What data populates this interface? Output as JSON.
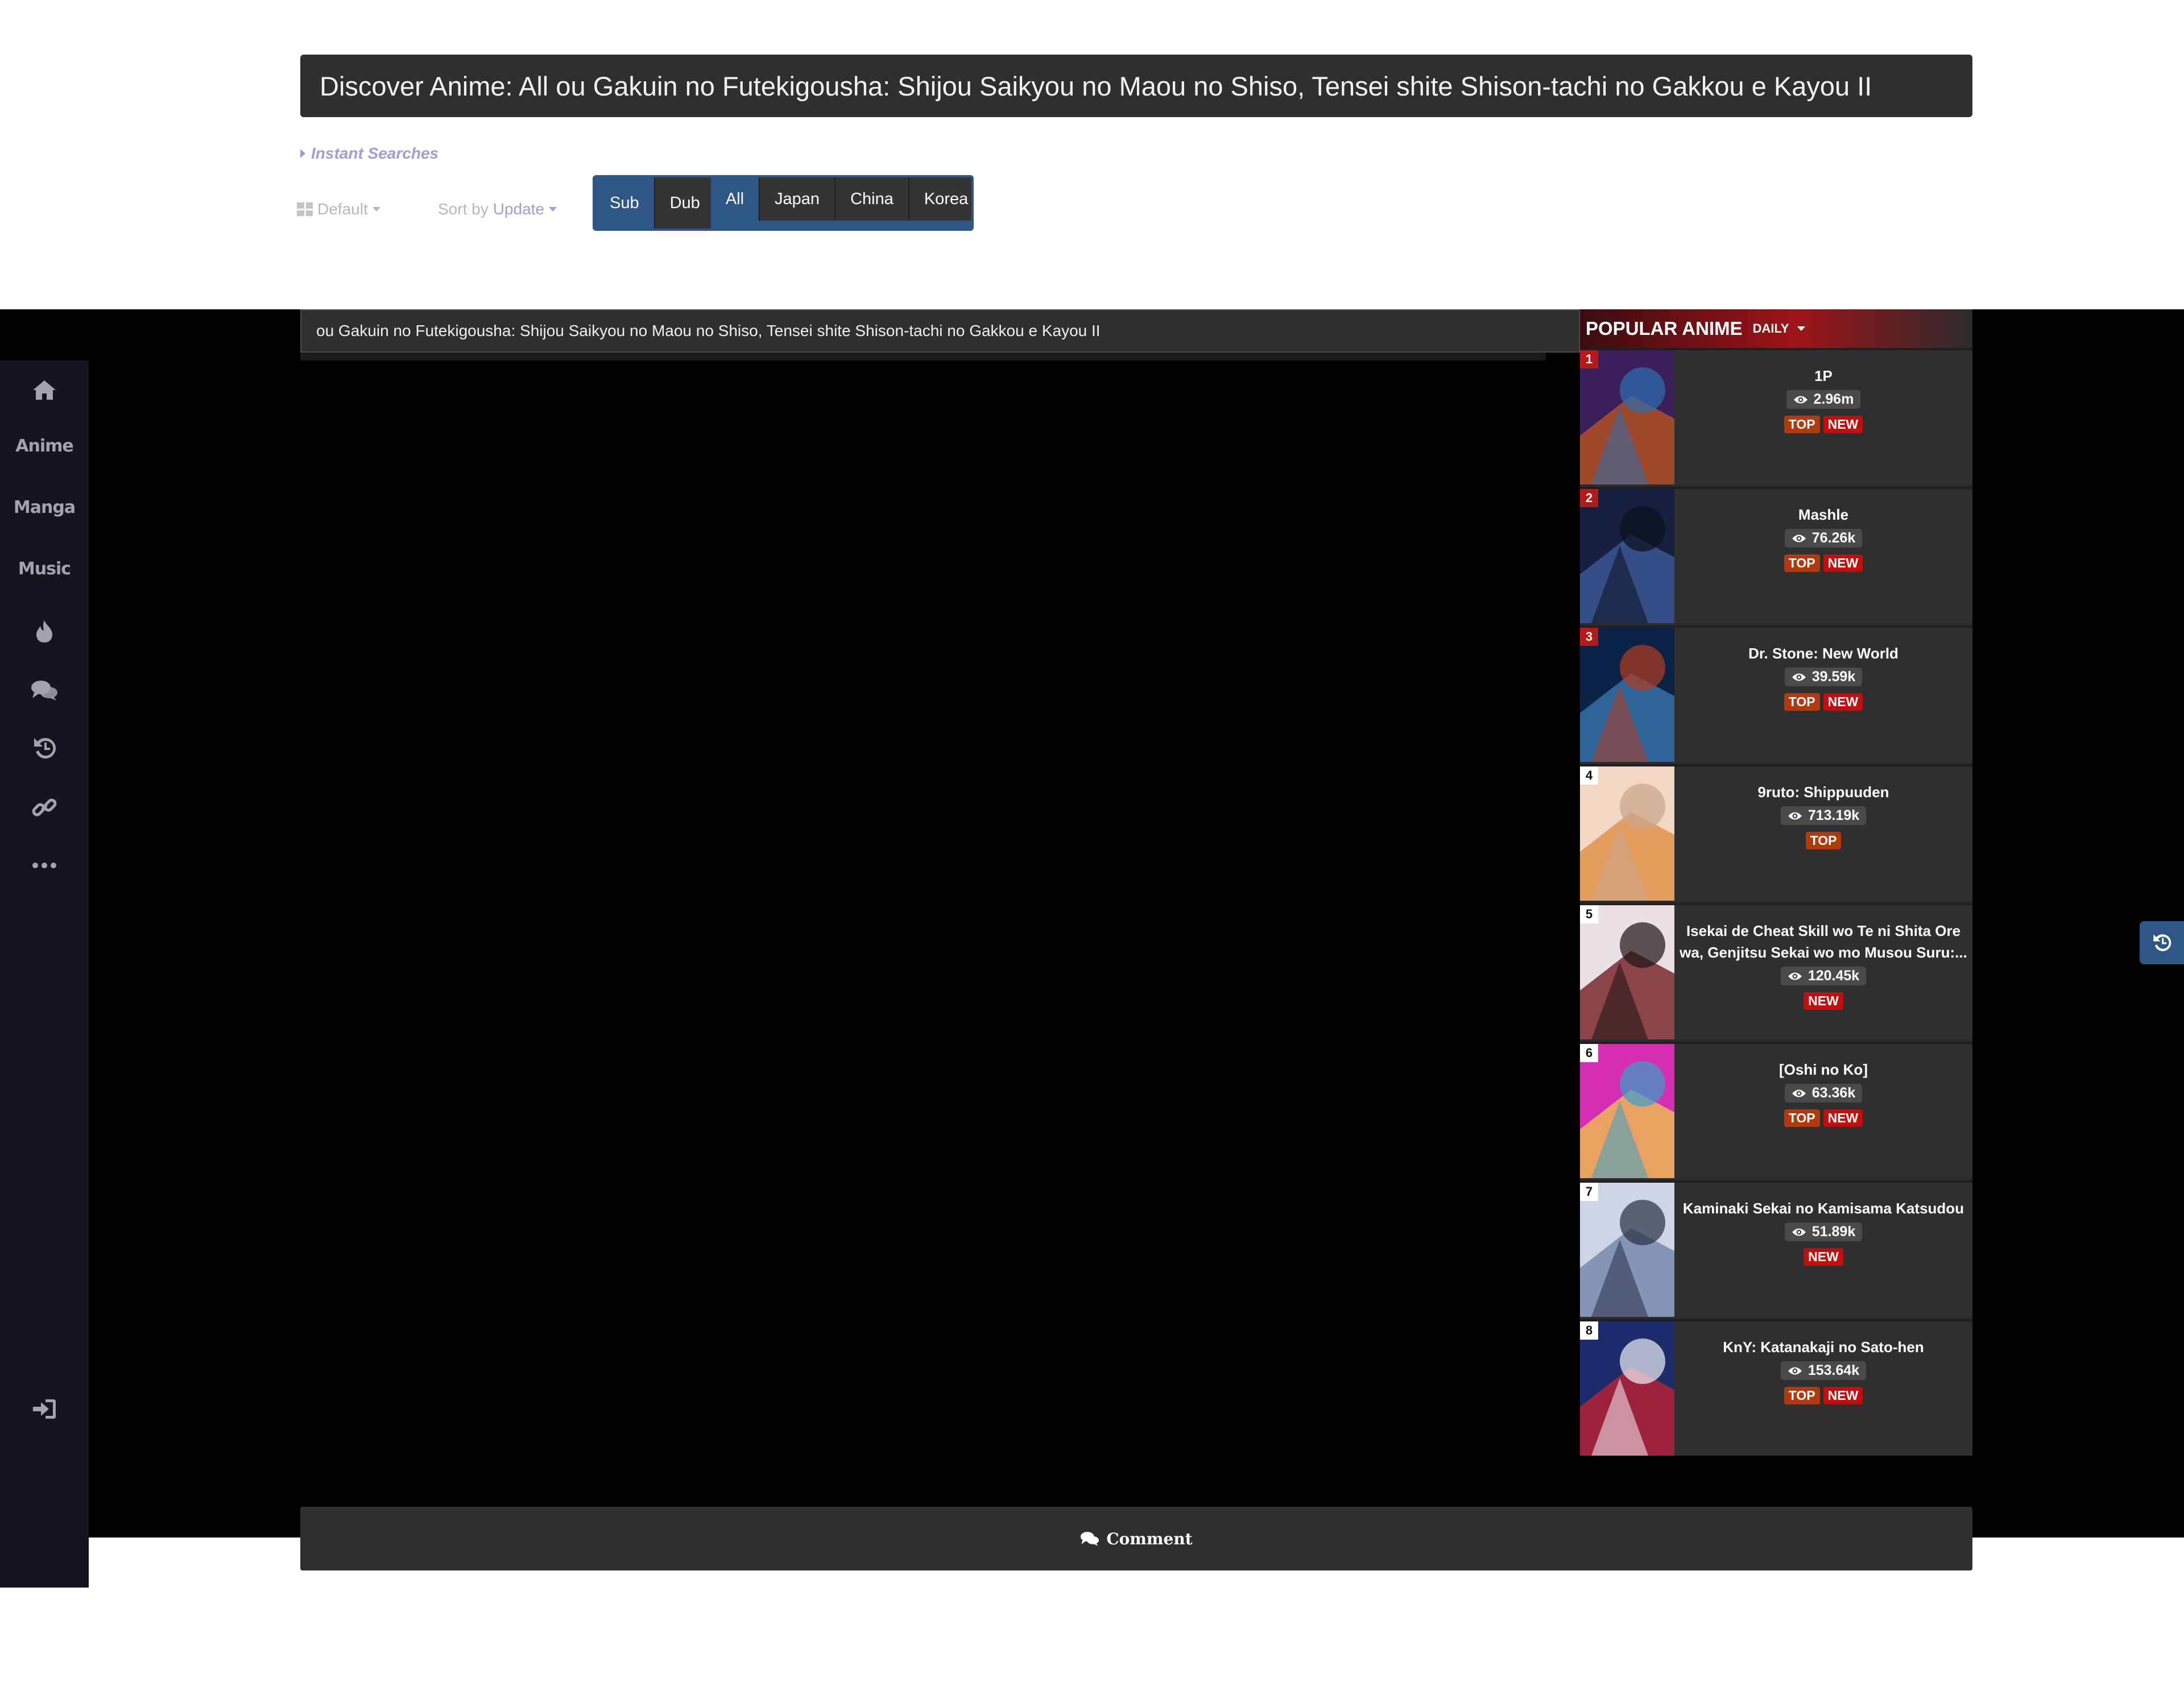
{
  "page": {
    "title": "Discover Anime: All ou Gakuin no Futekigousha: Shijou Saikyou no Maou no Shiso, Tensei shite Shison-tachi no Gakkou e Kayou II"
  },
  "filters": {
    "instant_searches": "Instant Searches",
    "view_label": "Default",
    "sort_prefix": "Sort by",
    "sort_value": "Update",
    "language": [
      {
        "label": "Sub",
        "active": true
      },
      {
        "label": "Dub",
        "active": false
      }
    ],
    "region": [
      {
        "label": "All",
        "active": true
      },
      {
        "label": "Japan",
        "active": false
      },
      {
        "label": "China",
        "active": false
      },
      {
        "label": "Korea",
        "active": false
      }
    ]
  },
  "search": {
    "value": "ou Gakuin no Futekigousha: Shijou Saikyou no Maou no Shiso, Tensei shite Shison-tachi no Gakkou e Kayou II"
  },
  "sidebar": {
    "items": [
      {
        "type": "icon",
        "icon": "home-icon"
      },
      {
        "type": "text",
        "label": "Anime"
      },
      {
        "type": "text",
        "label": "Manga"
      },
      {
        "type": "text",
        "label": "Music"
      },
      {
        "type": "icon",
        "icon": "fire-icon"
      },
      {
        "type": "icon",
        "icon": "comments-icon"
      },
      {
        "type": "icon",
        "icon": "history-icon"
      },
      {
        "type": "icon",
        "icon": "link-icon"
      },
      {
        "type": "icon",
        "icon": "more-icon"
      },
      {
        "type": "icon",
        "icon": "sign-in-icon"
      }
    ]
  },
  "popular": {
    "title": "POPULAR ANIME",
    "period": "DAILY",
    "items": [
      {
        "rank": "1",
        "name": "1P",
        "views": "2.96m",
        "top": "TOP",
        "new": "NEW",
        "colors": [
          "#3a1f5a",
          "#c2571d",
          "#2b6fb0"
        ]
      },
      {
        "rank": "2",
        "name": "Mashle",
        "views": "76.26k",
        "top": "TOP",
        "new": "NEW",
        "colors": [
          "#17213f",
          "#3f5fa0",
          "#0d0f1c"
        ]
      },
      {
        "rank": "3",
        "name": "Dr. Stone: New World",
        "views": "39.59k",
        "top": "TOP",
        "new": "NEW",
        "colors": [
          "#0a2346",
          "#3a79b6",
          "#b23a1b"
        ]
      },
      {
        "rank": "4",
        "name": "9ruto: Shippuuden",
        "views": "713.19k",
        "top": "TOP",
        "new": "",
        "colors": [
          "#f1d7c4",
          "#e08a3c",
          "#c9a58c"
        ]
      },
      {
        "rank": "5",
        "name": "Isekai de Cheat Skill wo Te ni Shita Ore wa, Genjitsu Sekai wo mo Musou Suru:...",
        "views": "120.45k",
        "top": "",
        "new": "NEW",
        "colors": [
          "#e9e1e3",
          "#6b0f14",
          "#1c1416"
        ]
      },
      {
        "rank": "6",
        "name": "[Oshi no Ko]",
        "views": "63.36k",
        "top": "TOP",
        "new": "NEW",
        "colors": [
          "#d42fb1",
          "#f1c94a",
          "#36a0c9"
        ]
      },
      {
        "rank": "7",
        "name": "Kaminaki Sekai no Kamisama Katsudou",
        "views": "51.89k",
        "top": "",
        "new": "NEW",
        "colors": [
          "#cfd5e6",
          "#6c7fa6",
          "#2a2d45"
        ]
      },
      {
        "rank": "8",
        "name": "KnY: Katanakaji no Sato-hen",
        "views": "153.64k",
        "top": "TOP",
        "new": "NEW",
        "colors": [
          "#1c2b6b",
          "#c8202b",
          "#f1f1f5"
        ]
      }
    ]
  },
  "comment": {
    "label": "Comment"
  }
}
